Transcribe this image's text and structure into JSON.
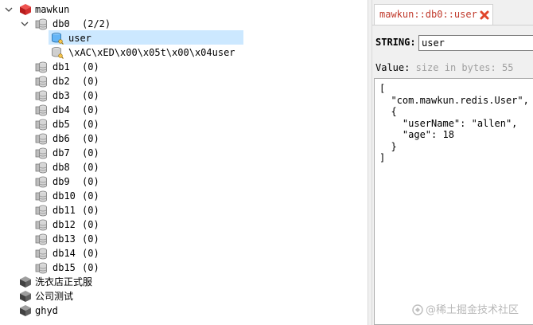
{
  "tree": {
    "connections": [
      {
        "name": "mawkun",
        "expanded": true
      },
      {
        "name": "洗衣店正式服",
        "expanded": false
      },
      {
        "name": "公司测试",
        "expanded": false
      },
      {
        "name": "ghyd",
        "expanded": false
      }
    ],
    "db0": {
      "name": "db0",
      "count": "(2/2)",
      "expanded": true
    },
    "keys": [
      "user",
      "\\xAC\\xED\\x00\\x05t\\x00\\x04user"
    ],
    "selected_key": "user",
    "databases": [
      {
        "name": "db1",
        "count": "(0)"
      },
      {
        "name": "db2",
        "count": "(0)"
      },
      {
        "name": "db3",
        "count": "(0)"
      },
      {
        "name": "db4",
        "count": "(0)"
      },
      {
        "name": "db5",
        "count": "(0)"
      },
      {
        "name": "db6",
        "count": "(0)"
      },
      {
        "name": "db7",
        "count": "(0)"
      },
      {
        "name": "db8",
        "count": "(0)"
      },
      {
        "name": "db9",
        "count": "(0)"
      },
      {
        "name": "db10",
        "count": "(0)"
      },
      {
        "name": "db11",
        "count": "(0)"
      },
      {
        "name": "db12",
        "count": "(0)"
      },
      {
        "name": "db13",
        "count": "(0)"
      },
      {
        "name": "db14",
        "count": "(0)"
      },
      {
        "name": "db15",
        "count": "(0)"
      }
    ]
  },
  "tab": {
    "label": "mawkun::db0::user"
  },
  "key_view": {
    "type_label": "STRING:",
    "key_name": "user",
    "value_label": "Value:",
    "size_hint": "size in bytes: 55",
    "value_text": "[\n  \"com.mawkun.redis.User\",\n  {\n    \"userName\": \"allen\",\n    \"age\": 18\n  }\n]"
  },
  "watermark": "@稀土掘金技术社区",
  "colors": {
    "server_red": "#d32f2f",
    "tab_text": "#c0392b",
    "close_red": "#e0452b",
    "selection": "#cce8ff"
  }
}
